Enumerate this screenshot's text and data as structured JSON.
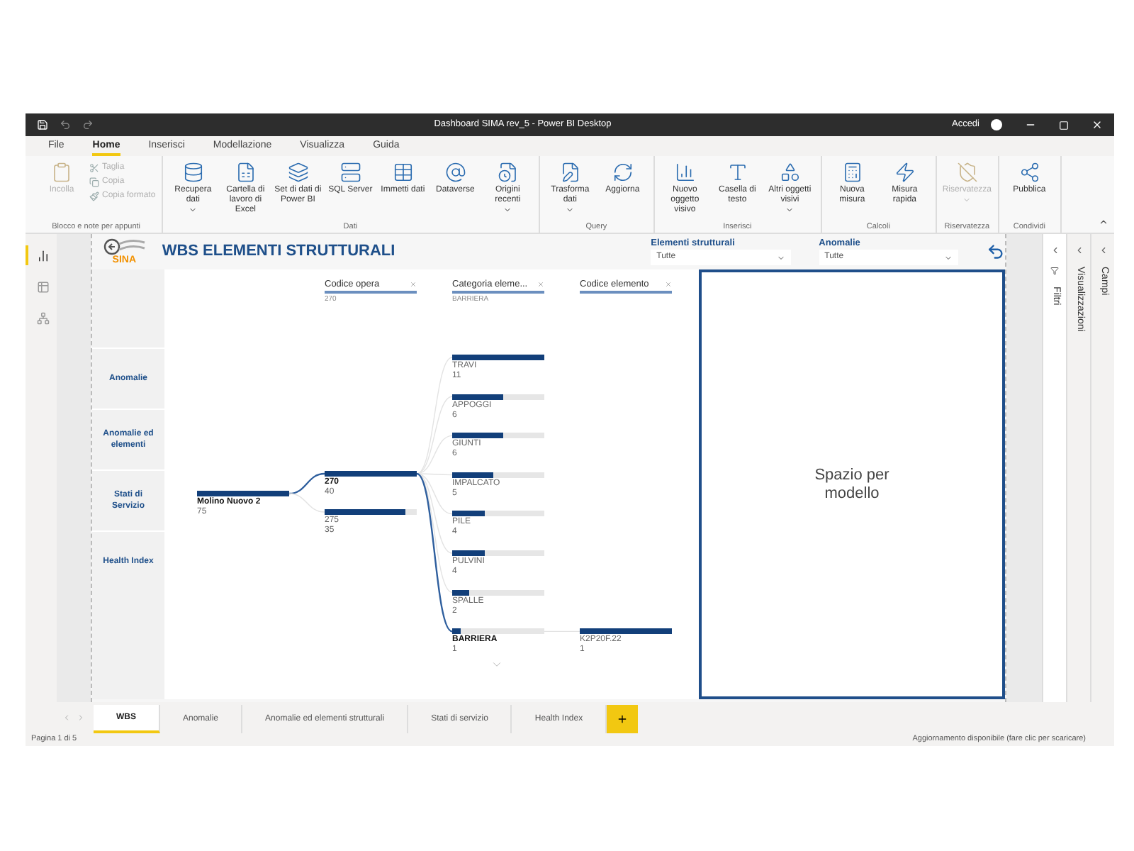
{
  "window": {
    "title": "Dashboard SIMA rev_5 - Power BI Desktop",
    "account": "Accedi"
  },
  "menu_tabs": [
    {
      "label": "File",
      "selected": false
    },
    {
      "label": "Home",
      "selected": true
    },
    {
      "label": "Inserisci",
      "selected": false
    },
    {
      "label": "Modellazione",
      "selected": false
    },
    {
      "label": "Visualizza",
      "selected": false
    },
    {
      "label": "Guida",
      "selected": false
    }
  ],
  "ribbon": [
    {
      "name": "Blocco e note per appunti",
      "buttons": [
        {
          "label": "Incolla",
          "kind": "large",
          "disabled": true,
          "dropdown": false
        },
        {
          "label": "Taglia",
          "kind": "small",
          "disabled": true
        },
        {
          "label": "Copia",
          "kind": "small",
          "disabled": true
        },
        {
          "label": "Copia formato",
          "kind": "small",
          "disabled": true
        }
      ]
    },
    {
      "name": "Dati",
      "buttons": [
        {
          "label": "Recupera dati",
          "kind": "large",
          "disabled": false,
          "dropdown": true
        },
        {
          "label": "Cartella di lavoro di Excel",
          "kind": "large",
          "disabled": false,
          "dropdown": false
        },
        {
          "label": "Set di dati di Power BI",
          "kind": "large",
          "disabled": false,
          "dropdown": false
        },
        {
          "label": "SQL Server",
          "kind": "large",
          "disabled": false,
          "dropdown": false
        },
        {
          "label": "Immetti dati",
          "kind": "large",
          "disabled": false,
          "dropdown": false
        },
        {
          "label": "Dataverse",
          "kind": "large",
          "disabled": false,
          "dropdown": false
        },
        {
          "label": "Origini recenti",
          "kind": "large",
          "disabled": false,
          "dropdown": true
        }
      ]
    },
    {
      "name": "Query",
      "buttons": [
        {
          "label": "Trasforma dati",
          "kind": "large",
          "disabled": false,
          "dropdown": true
        },
        {
          "label": "Aggiorna",
          "kind": "large",
          "disabled": false,
          "dropdown": false
        }
      ]
    },
    {
      "name": "Inserisci",
      "buttons": [
        {
          "label": "Nuovo oggetto visivo",
          "kind": "large",
          "disabled": false,
          "dropdown": false
        },
        {
          "label": "Casella di testo",
          "kind": "large",
          "disabled": false,
          "dropdown": false
        },
        {
          "label": "Altri oggetti visivi",
          "kind": "large",
          "disabled": false,
          "dropdown": true
        }
      ]
    },
    {
      "name": "Calcoli",
      "buttons": [
        {
          "label": "Nuova misura",
          "kind": "large",
          "disabled": false,
          "dropdown": false
        },
        {
          "label": "Misura rapida",
          "kind": "large",
          "disabled": false,
          "dropdown": false
        }
      ]
    },
    {
      "name": "Riservatezza",
      "buttons": [
        {
          "label": "Riservatezza",
          "kind": "large",
          "disabled": true,
          "dropdown": true
        }
      ]
    },
    {
      "name": "Condividi",
      "buttons": [
        {
          "label": "Pubblica",
          "kind": "large",
          "disabled": false,
          "dropdown": false
        }
      ]
    }
  ],
  "left_nav": [
    {
      "kind": "report",
      "selected": true
    },
    {
      "kind": "data",
      "selected": false
    },
    {
      "kind": "model",
      "selected": false
    }
  ],
  "report": {
    "logo": "SINA",
    "title": "WBS ELEMENTI STRUTTURALI",
    "slicers": [
      {
        "label": "Elementi strutturali",
        "value": "Tutte"
      },
      {
        "label": "Anomalie",
        "value": "Tutte"
      }
    ],
    "nav_buttons": [
      "Anomalie",
      "Anomalie ed elementi",
      "Stati di Servizio",
      "Health Index"
    ],
    "tree": {
      "root": {
        "label": "Molino Nuovo 2",
        "value": "75",
        "level": 1,
        "selected": true
      },
      "levels": [
        {
          "header": "Codice opera",
          "filter": "270",
          "nodes": [
            {
              "label": "270",
              "value": "40",
              "level": 1,
              "selected": true
            },
            {
              "label": "275",
              "value": "35",
              "level": 0.88,
              "selected": false
            }
          ]
        },
        {
          "header": "Categoria eleme...",
          "filter": "BARRIERA",
          "nodes": [
            {
              "label": "TRAVI",
              "value": "11",
              "level": 1,
              "selected": false
            },
            {
              "label": "APPOGGI",
              "value": "6",
              "level": 0.55,
              "selected": false
            },
            {
              "label": "GIUNTI",
              "value": "6",
              "level": 0.55,
              "selected": false
            },
            {
              "label": "IMPALCATO",
              "value": "5",
              "level": 0.45,
              "selected": false
            },
            {
              "label": "PILE",
              "value": "4",
              "level": 0.36,
              "selected": false
            },
            {
              "label": "PULVINI",
              "value": "4",
              "level": 0.36,
              "selected": false
            },
            {
              "label": "SPALLE",
              "value": "2",
              "level": 0.18,
              "selected": false
            },
            {
              "label": "BARRIERA",
              "value": "1",
              "level": 0.09,
              "selected": true
            }
          ]
        },
        {
          "header": "Codice elemento",
          "nodes": [
            {
              "label": "K2P20F.22",
              "value": "1",
              "level": 1,
              "selected": false
            }
          ]
        }
      ]
    },
    "placeholder": "Spazio per modello"
  },
  "panes": [
    {
      "label": "Filtri",
      "kind": "filters"
    },
    {
      "label": "Visualizzazioni",
      "kind": "plain"
    },
    {
      "label": "Campi",
      "kind": "plain"
    }
  ],
  "page_tabs": [
    {
      "label": "WBS",
      "selected": true
    },
    {
      "label": "Anomalie",
      "selected": false
    },
    {
      "label": "Anomalie ed elementi strutturali",
      "selected": false
    },
    {
      "label": "Stati di servizio",
      "selected": false
    },
    {
      "label": "Health Index",
      "selected": false
    }
  ],
  "status_bar": {
    "left": "Pagina 1 di 5",
    "right": "Aggiornamento disponibile (fare clic per scaricare)"
  }
}
